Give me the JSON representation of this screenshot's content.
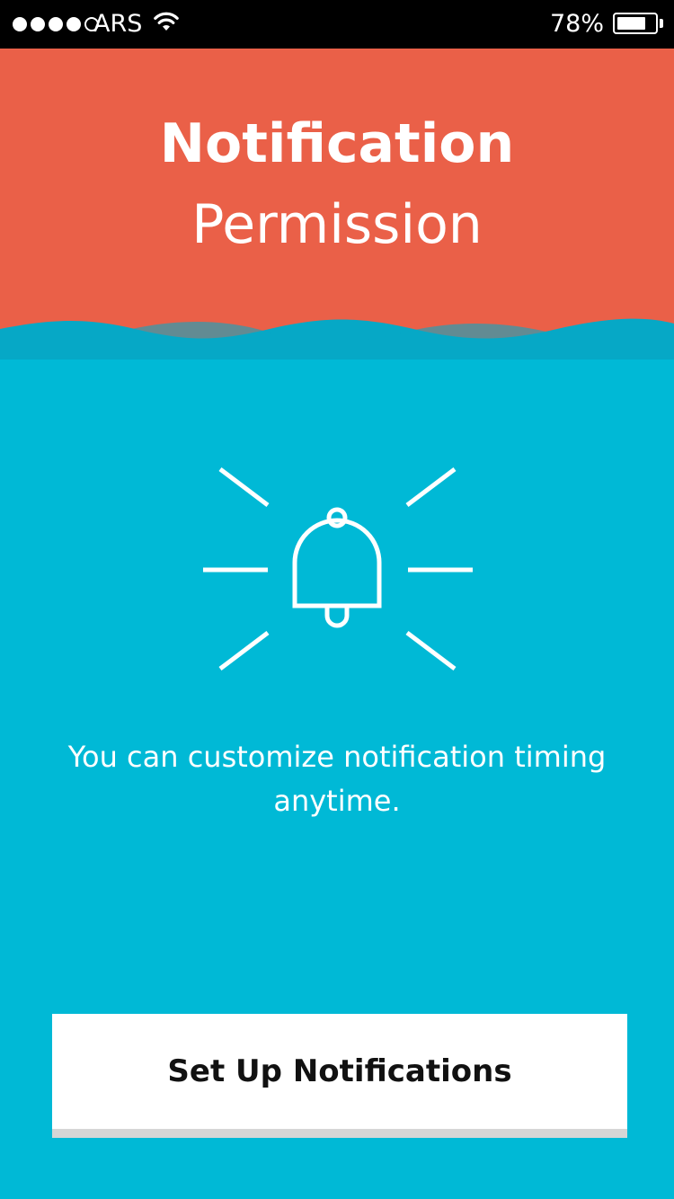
{
  "status_bar": {
    "carrier": "ARS",
    "battery_percent_label": "78%",
    "battery_level": 0.78,
    "signal_bars_filled": 4,
    "signal_bars_total": 5,
    "wifi_icon": "wifi-icon",
    "battery_icon": "battery-icon"
  },
  "header": {
    "title_line1": "Notification",
    "title_line2": "Permission",
    "background_color": "#ea6048"
  },
  "main": {
    "illustration_icon": "ringing-bell-icon",
    "message": "You can customize notification timing anytime.",
    "background_color": "#00b9d6"
  },
  "cta": {
    "label": "Set Up Notifications"
  }
}
